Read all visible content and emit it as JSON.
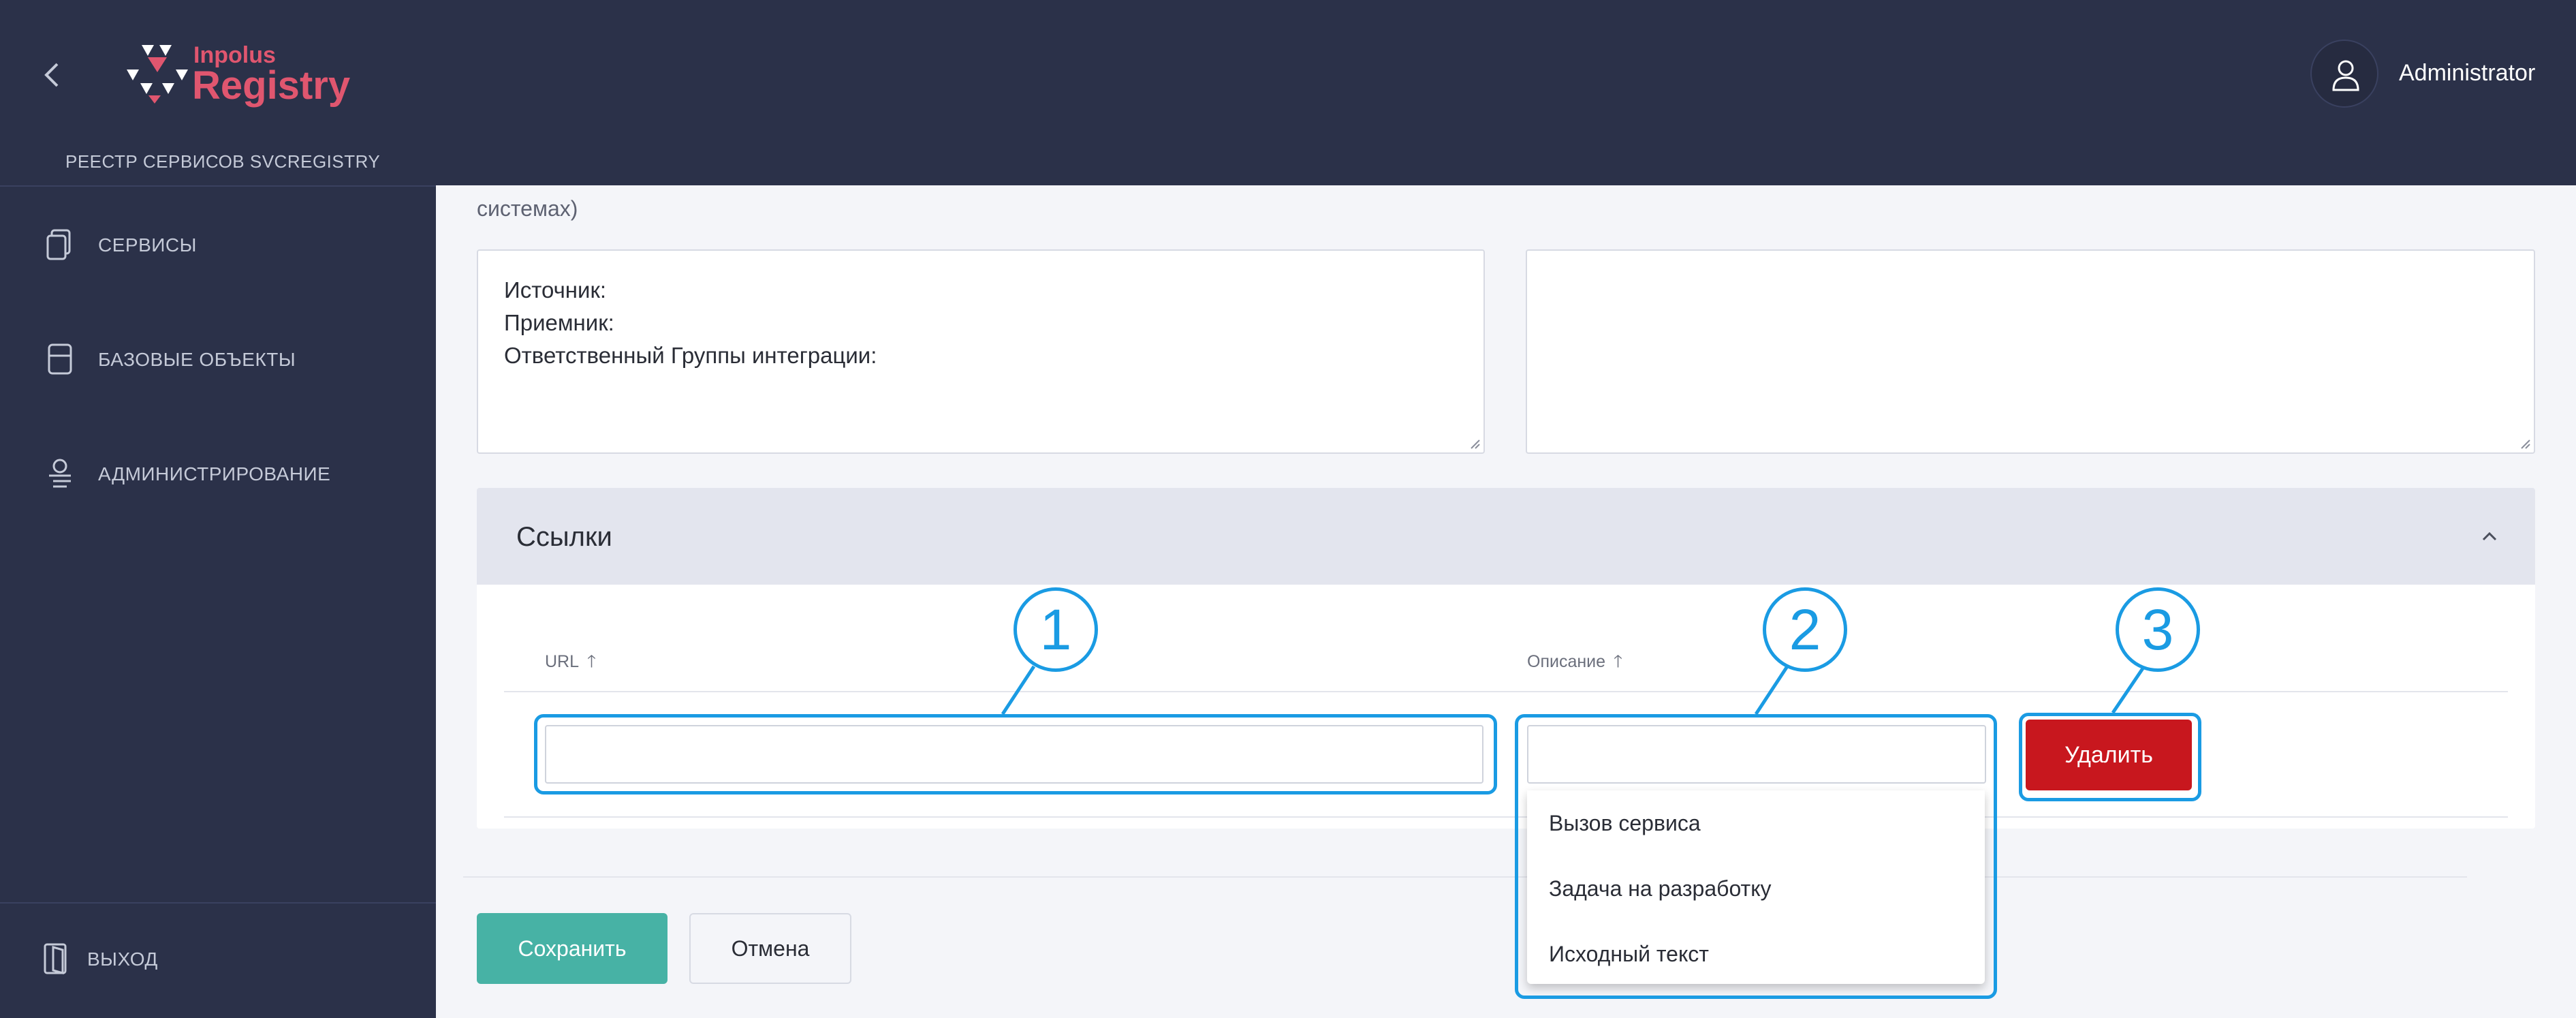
{
  "header": {
    "brand_small": "Inpolus",
    "brand_big": "Registry",
    "subtitle": "РЕЕСТР СЕРВИСОВ SVCREGISTRY",
    "user_name": "Administrator",
    "back_icon": "chevron-left-icon",
    "avatar_icon": "user-icon"
  },
  "sidebar": {
    "items": [
      {
        "label": "СЕРВИСЫ",
        "icon": "documents-icon"
      },
      {
        "label": "БАЗОВЫЕ ОБЪЕКТЫ",
        "icon": "box-icon"
      },
      {
        "label": "АДМИНИСТРИРОВАНИЕ",
        "icon": "admin-icon"
      }
    ],
    "logout_label": "ВЫХОД",
    "logout_icon": "door-icon"
  },
  "main": {
    "cut_text": "системах)",
    "textarea_left": "Источник:\nПриемник:\nОтветственный Группы интеграции:",
    "textarea_right": "",
    "links": {
      "title": "Ссылки",
      "col_url": "URL",
      "col_description": "Описание",
      "url_value": "",
      "description_value": "",
      "delete_label": "Удалить",
      "dropdown_options": [
        "Вызов сервиса",
        "Задача на разработку",
        "Исходный текст"
      ]
    },
    "callouts": [
      "1",
      "2",
      "3"
    ],
    "save_label": "Сохранить",
    "cancel_label": "Отмена"
  },
  "colors": {
    "header_bg": "#2b3149",
    "brand": "#e0566f",
    "delete": "#c8171e",
    "save": "#47b2a5",
    "callout": "#1a9be3"
  }
}
